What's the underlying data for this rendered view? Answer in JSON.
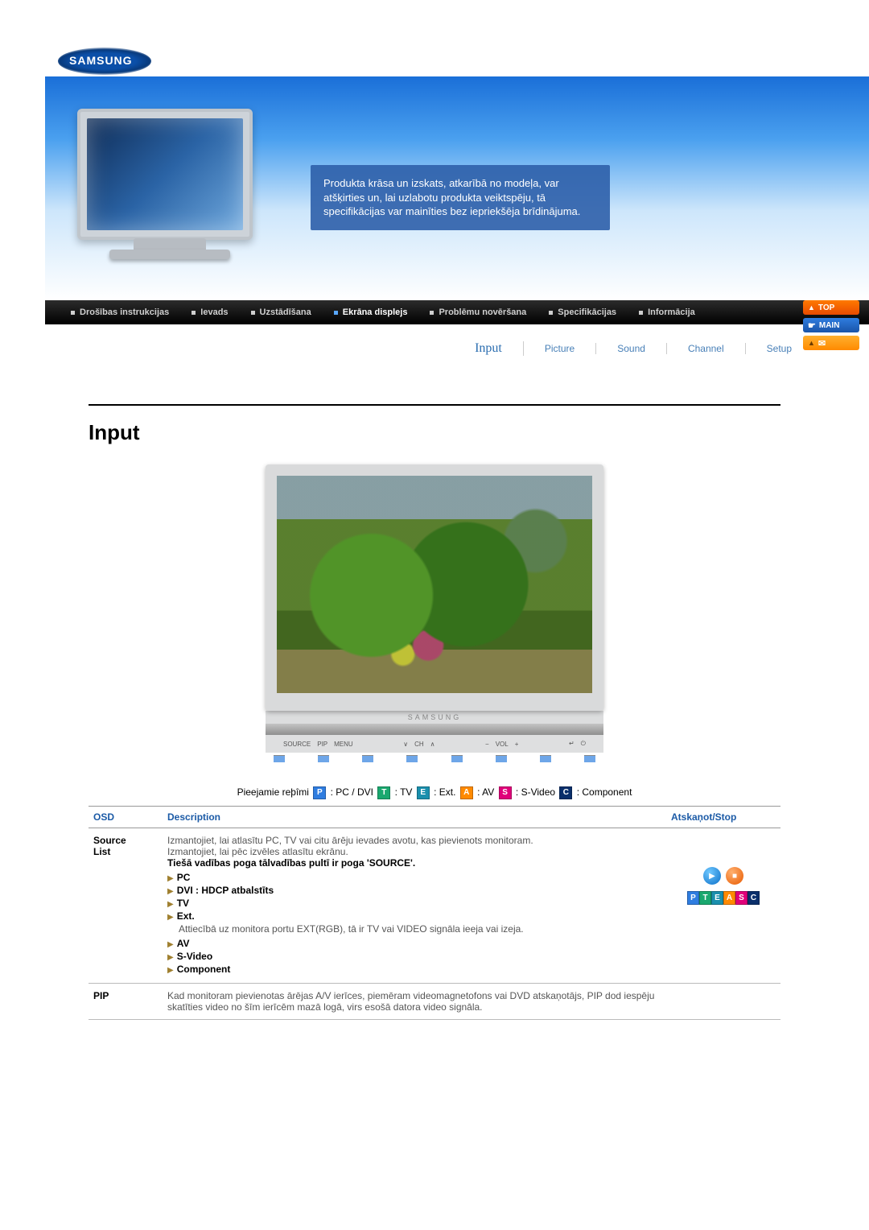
{
  "brand": "SAMSUNG",
  "banner_text": "Produkta krāsa un izskats, atkarībā no modeļa, var atšķirties un, lai uzlabotu produkta veiktspēju, tā specifikācijas var mainīties bez iepriekšēja brīdinājuma.",
  "nav": {
    "items": [
      {
        "label": "Drošības instrukcijas"
      },
      {
        "label": "Ievads"
      },
      {
        "label": "Uzstādīšana"
      },
      {
        "label": "Ekrāna displejs"
      },
      {
        "label": "Problēmu novēršana"
      },
      {
        "label": "Specifikācijas"
      },
      {
        "label": "Informācija"
      }
    ],
    "active_index": 3
  },
  "side_buttons": {
    "top": "TOP",
    "main": "MAIN"
  },
  "subnav": {
    "items": [
      "Input",
      "Picture",
      "Sound",
      "Channel",
      "Setup"
    ],
    "active_index": 0
  },
  "section_heading": "Input",
  "tv_brand_label": "SAMSUNG",
  "tv_controls": {
    "left": [
      "SOURCE",
      "PIP",
      "MENU"
    ],
    "mid_ch": [
      "∨",
      "CH",
      "∧"
    ],
    "mid_vol": [
      "−",
      "VOL",
      "+"
    ],
    "enter_icon": "↵",
    "power_icon": "⏻"
  },
  "modes": {
    "prefix": "Pieejamie reþîmi",
    "badges": [
      {
        "code": "P",
        "label": "PC / DVI"
      },
      {
        "code": "T",
        "label": "TV"
      },
      {
        "code": "E",
        "label": "Ext."
      },
      {
        "code": "A",
        "label": "AV"
      },
      {
        "code": "S",
        "label": "S-Video"
      },
      {
        "code": "C",
        "label": "Component"
      }
    ]
  },
  "table": {
    "headers": {
      "osd": "OSD",
      "desc": "Description",
      "play": "Atskaņot/Stop"
    },
    "rows": [
      {
        "osd": "Source List",
        "desc": {
          "p1": "Izmantojiet, lai atlasītu PC, TV vai citu ārēju ievades avotu, kas pievienots monitoram.",
          "p2": "Izmantojiet, lai pēc izvēles atlasītu ekrānu.",
          "p3": "Tiešā vadības poga tālvadības pultī ir poga 'SOURCE'.",
          "options": [
            {
              "label": "PC"
            },
            {
              "label": "DVI : HDCP atbalstīts"
            },
            {
              "label": "TV"
            },
            {
              "label": "Ext.",
              "note": "Attiecībā uz monitora portu EXT(RGB), tā ir TV vai VIDEO signāla ieeja vai izeja."
            },
            {
              "label": "AV"
            },
            {
              "label": "S-Video"
            },
            {
              "label": "Component"
            }
          ]
        },
        "badges": [
          "P",
          "T",
          "E",
          "A",
          "S",
          "C"
        ]
      },
      {
        "osd": "PIP",
        "desc": {
          "p1": "Kad monitoram pievienotas ārējas A/V ierīces, piemēram videomagnetofons vai DVD atskaņotājs, PIP dod iespēju skatīties video no šīm ierīcēm mazā logā, virs esošā datora video signāla."
        }
      }
    ]
  }
}
